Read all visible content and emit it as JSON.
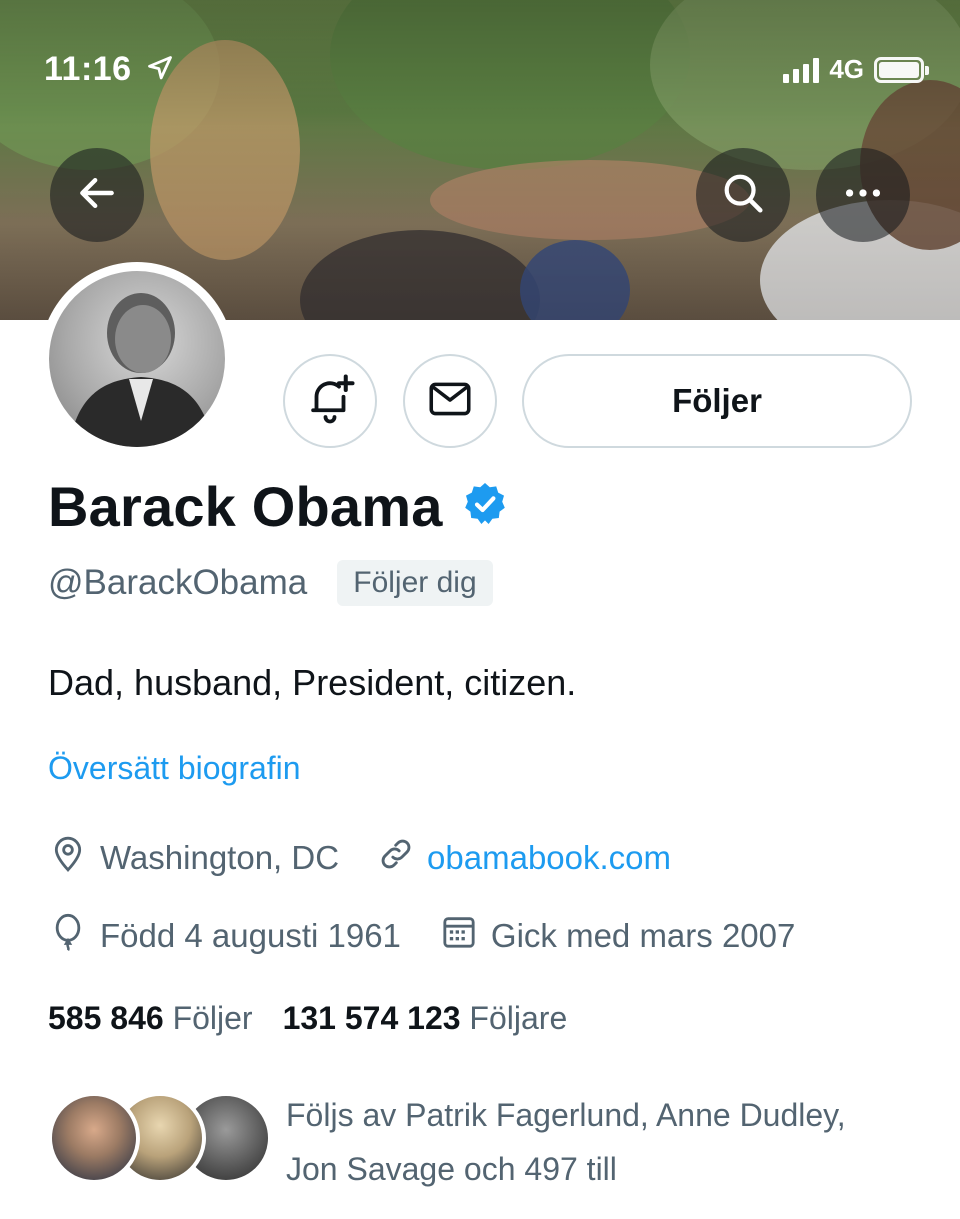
{
  "status_bar": {
    "time": "11:16",
    "network": "4G",
    "icons": [
      "location-arrow-icon",
      "signal-icon",
      "battery-icon"
    ]
  },
  "header": {
    "back_icon": "arrow-left-icon",
    "search_icon": "search-icon",
    "more_icon": "more-horizontal-icon"
  },
  "profile": {
    "display_name": "Barack Obama",
    "verified": true,
    "handle": "@BarackObama",
    "follows_you_badge": "Följer dig",
    "bio": "Dad, husband, President, citizen.",
    "translate_link": "Översätt biografin",
    "location": "Washington, DC",
    "website": "obamabook.com",
    "birth_date": "Född 4 augusti 1961",
    "joined": "Gick med mars 2007",
    "following_count": "585 846",
    "following_label": "Följer",
    "followers_count": "131 574 123",
    "followers_label": "Följare",
    "followed_by_line1": "Följs av Patrik Fagerlund, Anne Dudley,",
    "followed_by_line2": "Jon Savage och 497 till"
  },
  "actions": {
    "notify_icon": "bell-plus-icon",
    "message_icon": "envelope-icon",
    "follow_button_label": "Följer"
  },
  "colors": {
    "accent": "#1d9bf0",
    "text_primary": "#0f1419",
    "text_secondary": "#536471",
    "border": "#cfd9de"
  }
}
